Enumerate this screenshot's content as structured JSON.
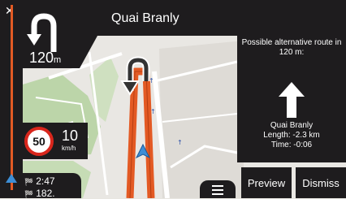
{
  "header": {
    "street": "Quai Branly"
  },
  "turn": {
    "distance_value": "120",
    "distance_unit": "m",
    "icon": "u-turn-left-icon"
  },
  "speed": {
    "limit": "50",
    "current": "10",
    "unit": "km/h"
  },
  "eta": {
    "time": "2:47",
    "distance": "182."
  },
  "alternative": {
    "heading": "Possible alternative route in 120 m:",
    "street": "Quai Branly",
    "length": "Length: -2.3 km",
    "time": "Time: -0:06"
  },
  "buttons": {
    "preview": "Preview",
    "dismiss": "Dismiss"
  },
  "colors": {
    "route": "#e35a24",
    "panel": "#1e1c1e",
    "position": "#3d8ed6"
  }
}
